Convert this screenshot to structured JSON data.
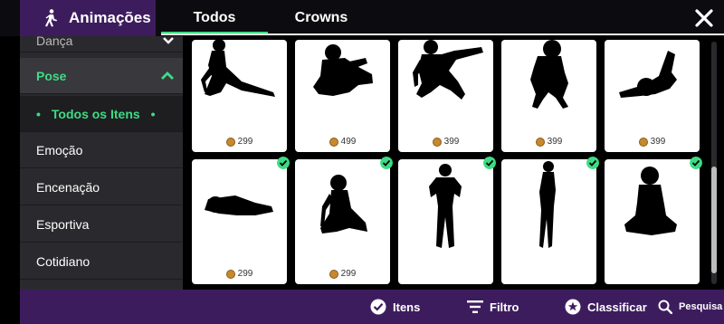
{
  "header": {
    "title": "Animações",
    "title_icon": "walking-person-icon",
    "tabs": [
      {
        "label": "Todos",
        "active": true
      },
      {
        "label": "Crowns",
        "active": false
      }
    ],
    "close_icon": "close-icon"
  },
  "sidebar": {
    "items": [
      {
        "label": "Dança"
      },
      {
        "label": "Pose",
        "expanded": true
      },
      {
        "label": "Todos os Itens",
        "selected": true
      },
      {
        "label": "Emoção"
      },
      {
        "label": "Encenação"
      },
      {
        "label": "Esportiva"
      },
      {
        "label": "Cotidiano"
      }
    ]
  },
  "grid": {
    "rows": [
      [
        {
          "pose": "sitting-stretch",
          "price": "299",
          "owned": false
        },
        {
          "pose": "lying-curled",
          "price": "499",
          "owned": false
        },
        {
          "pose": "squat-reach",
          "price": "399",
          "owned": false
        },
        {
          "pose": "crouching",
          "price": "399",
          "owned": false
        },
        {
          "pose": "lying-back",
          "price": "399",
          "owned": false
        }
      ],
      [
        {
          "pose": "lying-side",
          "price": "299",
          "owned": true
        },
        {
          "pose": "sitting-floor",
          "price": "299",
          "owned": true
        },
        {
          "pose": "standing-hands-hips",
          "price": "",
          "owned": true
        },
        {
          "pose": "standing-side",
          "price": "",
          "owned": true
        },
        {
          "pose": "cross-legged",
          "price": "",
          "owned": true
        }
      ]
    ]
  },
  "bottom_bar": {
    "itens_label": "Itens",
    "filtro_label": "Filtro",
    "classificar_label": "Classificar",
    "pesquisa_label": "Pesquisa"
  },
  "colors": {
    "accent": "#3ddc84",
    "purple": "#3d1c5e",
    "sidebar": "#2a2a2e",
    "coin": "#c7892e"
  },
  "scroll": {
    "position_fraction": 0.5
  }
}
